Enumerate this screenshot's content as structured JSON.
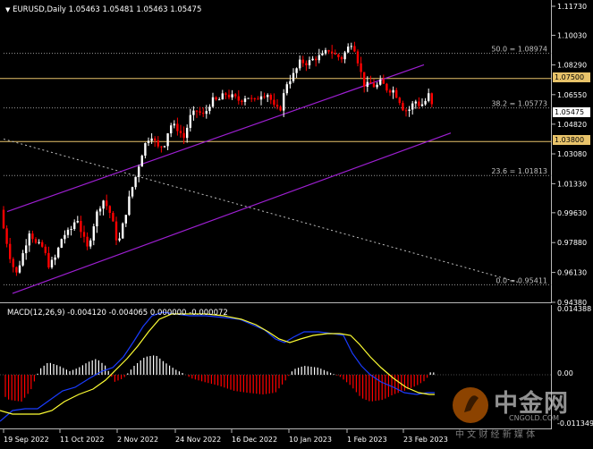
{
  "chart": {
    "symbol_header": "EURUSD,Daily",
    "ohlc": "1.05463 1.05481 1.05463 1.05475"
  },
  "price_axis": [
    "1.11730",
    "1.10030",
    "1.08290",
    "1.06550",
    "1.04820",
    "1.03080",
    "1.01330",
    "0.99630",
    "0.97880",
    "0.96130",
    "0.94380"
  ],
  "price_tags": {
    "resistance": "1.07500",
    "current": "1.05475",
    "support": "1.03800"
  },
  "fibo": [
    {
      "label": "50.0 = 1.08974",
      "price": 1.08974
    },
    {
      "label": "38.2 = 1.05773",
      "price": 1.05773
    },
    {
      "label": "23.6 = 1.01813",
      "price": 1.01813
    },
    {
      "label": "0.0 = 0.95411",
      "price": 0.95411
    }
  ],
  "macd": {
    "header": "MACD(12,26,9) -0.004120 -0.004065 0.000000 -0.000072",
    "axis": [
      "0.014388",
      "0.00",
      "-0.011349"
    ]
  },
  "date_axis": [
    "19 Sep 2022",
    "11 Oct 2022",
    "2 Nov 2022",
    "24 Nov 2022",
    "16 Dec 2022",
    "10 Jan 2023",
    "1 Feb 2023",
    "23 Feb 2023"
  ],
  "watermark": {
    "brand": "中金网",
    "domain": "CNGOLD.COM",
    "slogan": "中 文 财 经 新 媒 体"
  },
  "colors": {
    "bull": "#ffffff",
    "bear": "#ff0000",
    "channel": "#9d1fd1",
    "hline": "#e8c36a",
    "signal": "#ffff33",
    "macd_line": "#1a3cff"
  }
}
